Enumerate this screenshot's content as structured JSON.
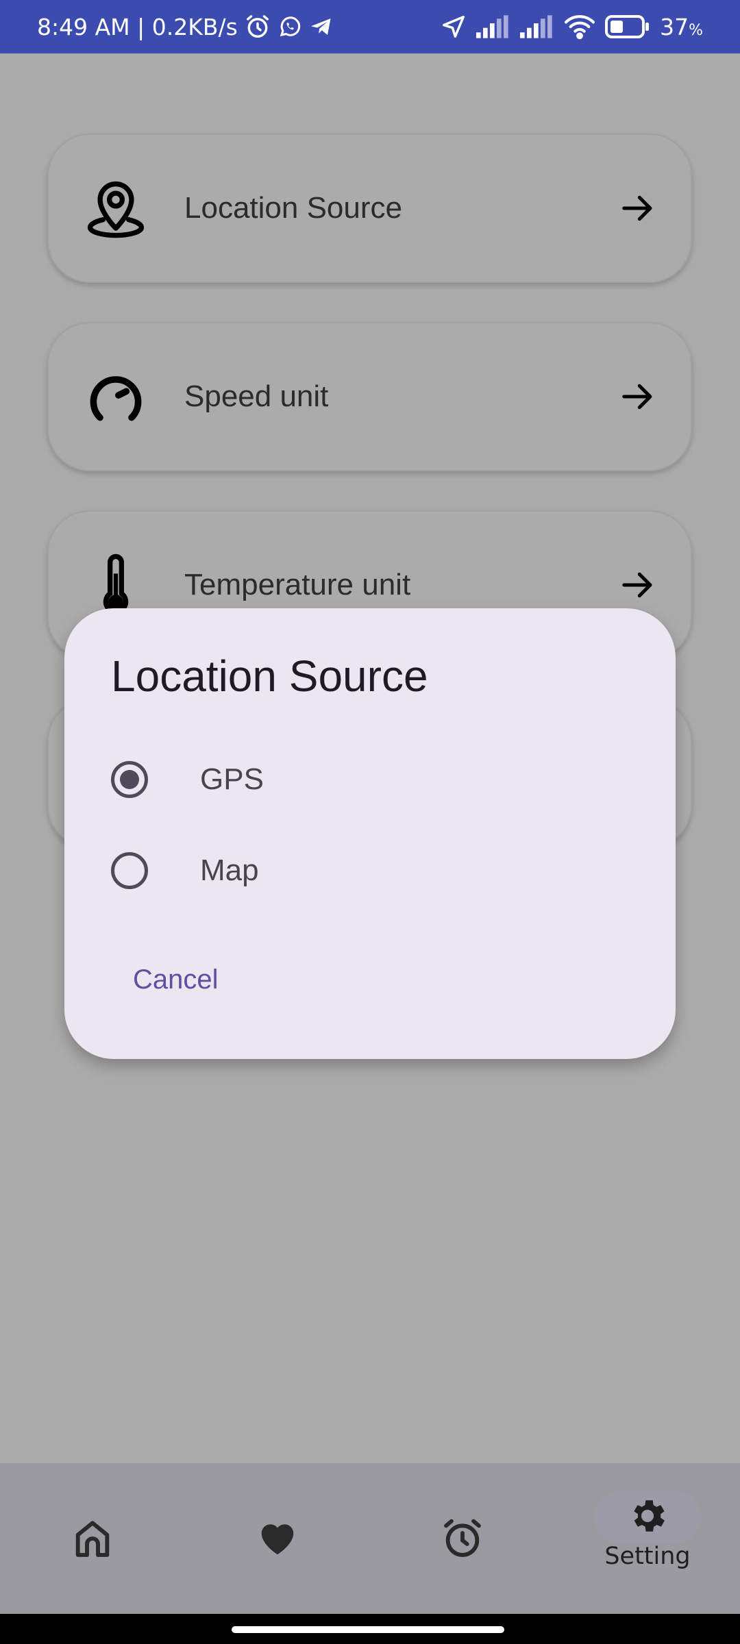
{
  "status_bar": {
    "time_and_speed": "8:49 AM | 0.2KB/s",
    "battery_text": "37",
    "battery_unit": "%"
  },
  "settings": {
    "items": [
      {
        "label": "Location Source",
        "icon": "location-pin-icon"
      },
      {
        "label": "Speed unit",
        "icon": "speedometer-icon"
      },
      {
        "label": "Temperature unit",
        "icon": "thermometer-icon"
      }
    ]
  },
  "dialog": {
    "title": "Location Source",
    "options": [
      {
        "label": "GPS",
        "selected": true
      },
      {
        "label": "Map",
        "selected": false
      }
    ],
    "cancel_label": "Cancel"
  },
  "bottom_nav": {
    "items": [
      {
        "icon": "home-icon"
      },
      {
        "icon": "heart-icon"
      },
      {
        "icon": "alarm-clock-icon"
      },
      {
        "icon": "gear-icon",
        "label": "Setting",
        "active": true
      }
    ]
  },
  "colors": {
    "status_bar": "#3c4bb0",
    "scrim_background": "#ababab",
    "dialog_background": "#ece6f1",
    "accent": "#5d50a0",
    "nav_background": "#9b9aa0"
  }
}
